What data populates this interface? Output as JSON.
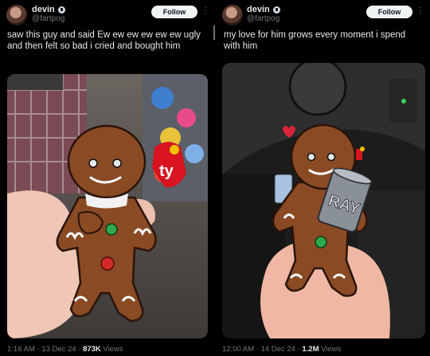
{
  "left": {
    "name": "devin",
    "handle": "@fartpog",
    "follow_label": "Follow",
    "more": "⋮",
    "text": "saw this guy and said Ew ew ew ew ew ew ugly and then felt so bad i cried and bought him",
    "image_alt": "Hand holding a gingerbread man plush with a Ty tag in a store",
    "time": "1:16 AM",
    "sep1": " · ",
    "date": "13 Dec 24",
    "sep2": " · ",
    "views_count": "873K",
    "views_label": " Views",
    "tag_text": "ty"
  },
  "right": {
    "name": "devin",
    "handle": "@fartpog",
    "follow_label": "Follow",
    "more": "⋮",
    "text": "my love for him grows every moment i spend with him",
    "image_alt": "Hand holding the gingerbread man plush in a car at night",
    "time": "12:00 AM",
    "sep1": " · ",
    "date": "14 Dec 24",
    "sep2": " · ",
    "views_count": "1.2M",
    "views_label": " Views",
    "can_text": "RAY"
  },
  "colors": {
    "background": "#000000",
    "text": "#e7e9ea",
    "secondary": "#71767b",
    "follow_bg": "#eff3f4",
    "cookie": "#8a4a24"
  }
}
